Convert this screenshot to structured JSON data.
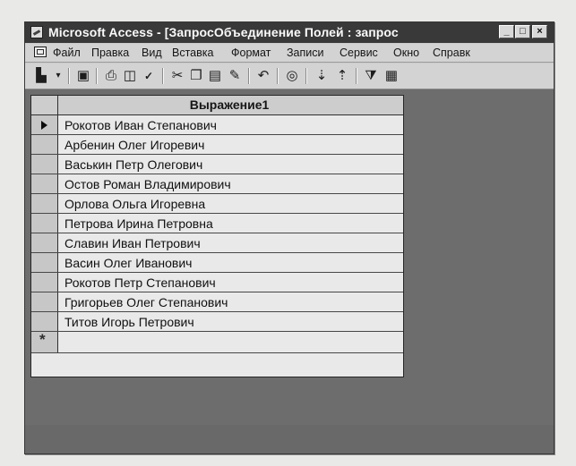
{
  "window": {
    "title": "Microsoft Access - [ЗапросОбъединение Полей : запрос",
    "icon": "access-key-icon"
  },
  "menu": {
    "items": [
      {
        "label": "Файл"
      },
      {
        "label": "Правка"
      },
      {
        "label": "Вид"
      },
      {
        "label": "Вставка"
      },
      {
        "label": "Формат"
      },
      {
        "label": "Записи"
      },
      {
        "label": "Сервис"
      },
      {
        "label": "Окно"
      },
      {
        "label": "Справк"
      }
    ]
  },
  "toolbar": {
    "icons": [
      "view-icon",
      "save-icon",
      "print-icon",
      "print-preview-icon",
      "spelling-icon",
      "cut-icon",
      "copy-icon",
      "paste-icon",
      "format-painter-icon",
      "undo-icon",
      "hyperlink-icon",
      "sort-ascending-icon",
      "sort-descending-icon",
      "filter-by-selection-icon",
      "filter-by-form-icon"
    ]
  },
  "datasheet": {
    "column_header": "Выражение1",
    "rows": [
      "Рокотов Иван Степанович",
      "Арбенин Олег Игоревич",
      "Васькин Петр Олегович",
      "Остов Роман Владимирович",
      "Орлова Ольга Игоревна",
      "Петрова Ирина Петровна",
      "Славин Иван Петрович",
      "Васин Олег Иванович",
      "Рокотов Петр Степанович",
      "Григорьев Олег Степанович",
      "Титов Игорь Петрович"
    ],
    "current_row": 0
  },
  "colors": {
    "titlebar": "#3c3c3c",
    "workspace": "#6e6e6c",
    "grid": "#e4e4e2"
  }
}
